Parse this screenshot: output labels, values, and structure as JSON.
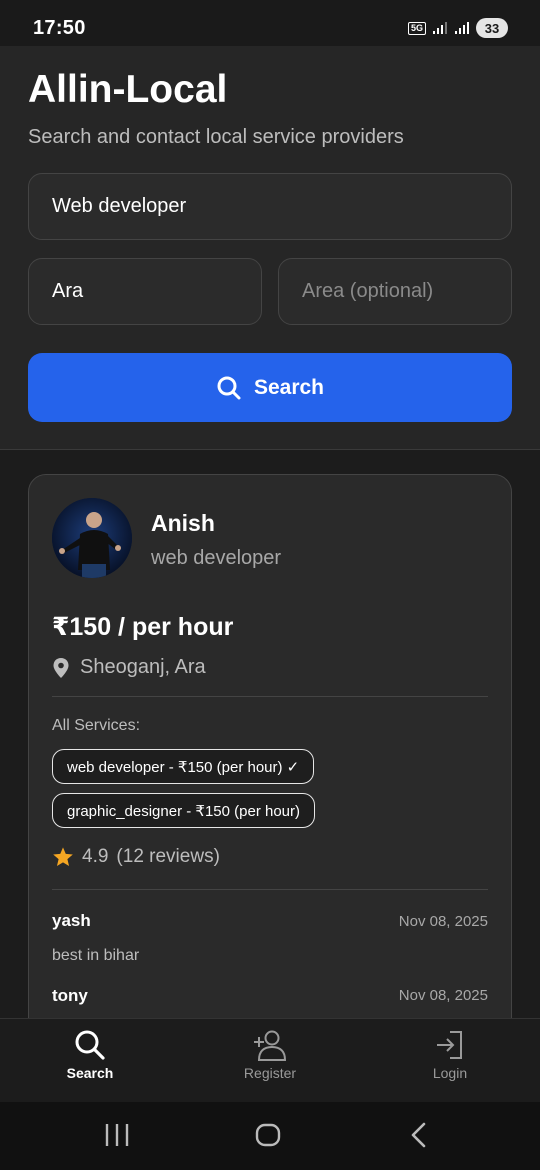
{
  "status_bar": {
    "time": "17:50",
    "network": "5G",
    "battery": "33"
  },
  "header": {
    "title": "Allin-Local",
    "subtitle": "Search and contact local service providers"
  },
  "search_form": {
    "service_value": "Web developer",
    "city_value": "Ara",
    "area_placeholder": "Area (optional)",
    "search_label": "Search"
  },
  "provider": {
    "name": "Anish",
    "role": "web developer",
    "rate": "₹150 / per hour",
    "location": "Sheoganj, Ara",
    "services_label": "All Services:",
    "services": [
      "web developer - ₹150 (per hour) ✓",
      "graphic_designer - ₹150 (per hour)"
    ],
    "rating_value": "4.9",
    "rating_count": "(12 reviews)",
    "reviews": [
      {
        "name": "yash",
        "date": "Nov 08, 2025",
        "text": "best in bihar"
      },
      {
        "name": "tony",
        "date": "Nov 08, 2025"
      }
    ]
  },
  "bottom_nav": {
    "items": [
      {
        "label": "Search",
        "icon": "search-icon",
        "active": true
      },
      {
        "label": "Register",
        "icon": "person-add-icon",
        "active": false
      },
      {
        "label": "Login",
        "icon": "login-icon",
        "active": false
      }
    ]
  },
  "colors": {
    "accent": "#2563eb",
    "background": "#1c1c1c",
    "panel": "#262626",
    "card": "#2a2a2a",
    "star": "#f5a623"
  }
}
